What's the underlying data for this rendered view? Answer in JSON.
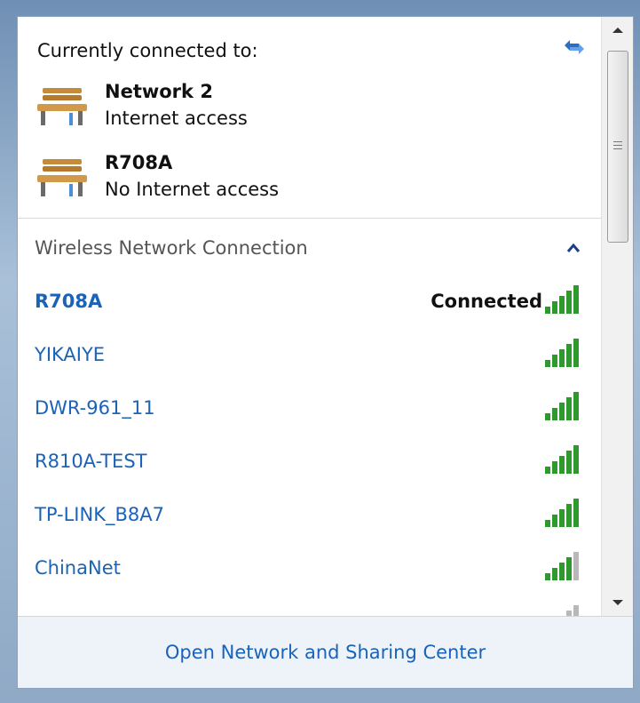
{
  "header": {
    "title": "Currently connected to:"
  },
  "connected": [
    {
      "name": "Network  2",
      "status": "Internet access"
    },
    {
      "name": "R708A",
      "status": "No Internet access"
    }
  ],
  "section": {
    "title": "Wireless Network Connection"
  },
  "networks": [
    {
      "name": "R708A",
      "status": "Connected",
      "signal_bars": 5
    },
    {
      "name": "YIKAIYE",
      "status": "",
      "signal_bars": 5
    },
    {
      "name": "DWR-961_11",
      "status": "",
      "signal_bars": 5
    },
    {
      "name": "R810A-TEST",
      "status": "",
      "signal_bars": 5
    },
    {
      "name": "TP-LINK_B8A7",
      "status": "",
      "signal_bars": 5
    },
    {
      "name": "ChinaNet",
      "status": "",
      "signal_bars": 4
    }
  ],
  "footer": {
    "link": "Open Network and Sharing Center"
  },
  "icons": {
    "refresh": "refresh-arrows-icon",
    "connection": "park-bench-icon",
    "collapse": "chevron-up-icon",
    "signal": "signal-bars-icon"
  },
  "colors": {
    "link": "#1a63b8",
    "signal_on": "#2e9a2e",
    "signal_off": "#b8b8b8"
  }
}
